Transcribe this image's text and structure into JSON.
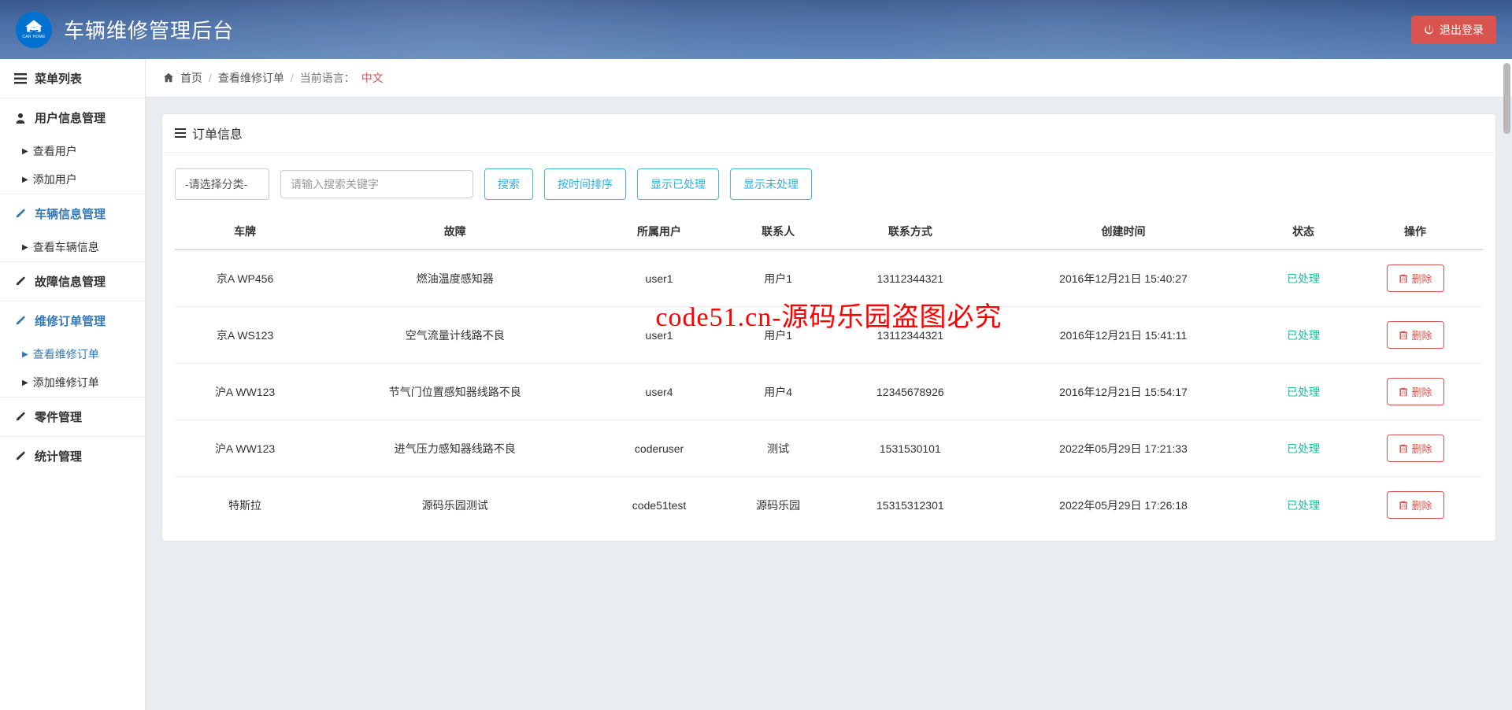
{
  "header": {
    "title": "车辆维修管理后台",
    "logo_text": "CAR HOME",
    "logout": "退出登录"
  },
  "sidebar": {
    "heading": "菜单列表",
    "groups": [
      {
        "icon": "user",
        "label": "用户信息管理",
        "active": false,
        "subs": [
          {
            "label": "查看用户",
            "active": false
          },
          {
            "label": "添加用户",
            "active": false
          }
        ]
      },
      {
        "icon": "edit",
        "label": "车辆信息管理",
        "active": true,
        "subs": [
          {
            "label": "查看车辆信息",
            "active": false
          }
        ]
      },
      {
        "icon": "edit",
        "label": "故障信息管理",
        "active": false,
        "subs": []
      },
      {
        "icon": "edit",
        "label": "维修订单管理",
        "active": true,
        "subs": [
          {
            "label": "查看维修订单",
            "active": true
          },
          {
            "label": "添加维修订单",
            "active": false
          }
        ]
      },
      {
        "icon": "edit",
        "label": "零件管理",
        "active": false,
        "subs": []
      },
      {
        "icon": "edit",
        "label": "统计管理",
        "active": false,
        "subs": []
      }
    ]
  },
  "breadcrumb": {
    "home": "首页",
    "current": "查看维修订单",
    "lang_label": "当前语言：",
    "lang_value": "中文"
  },
  "panel": {
    "title": "订单信息",
    "category_placeholder": "-请选择分类-",
    "search_placeholder": "请输入搜索关键字",
    "btn_search": "搜索",
    "btn_sort_time": "按时间排序",
    "btn_show_done": "显示已处理",
    "btn_show_undone": "显示未处理"
  },
  "table": {
    "columns": [
      "车牌",
      "故障",
      "所属用户",
      "联系人",
      "联系方式",
      "创建时间",
      "状态",
      "操作"
    ],
    "delete_label": "删除",
    "rows": [
      {
        "plate": "京A WP456",
        "fault": "燃油温度感知器",
        "user": "user1",
        "contact": "用户1",
        "phone": "13112344321",
        "time": "2016年12月21日 15:40:27",
        "status": "已处理"
      },
      {
        "plate": "京A WS123",
        "fault": "空气流量计线路不良",
        "user": "user1",
        "contact": "用户1",
        "phone": "13112344321",
        "time": "2016年12月21日 15:41:11",
        "status": "已处理"
      },
      {
        "plate": "沪A WW123",
        "fault": "节气门位置感知器线路不良",
        "user": "user4",
        "contact": "用户4",
        "phone": "12345678926",
        "time": "2016年12月21日 15:54:17",
        "status": "已处理"
      },
      {
        "plate": "沪A WW123",
        "fault": "进气压力感知器线路不良",
        "user": "coderuser",
        "contact": "测试",
        "phone": "1531530101",
        "time": "2022年05月29日 17:21:33",
        "status": "已处理"
      },
      {
        "plate": "特斯拉",
        "fault": "源码乐园测试",
        "user": "code51test",
        "contact": "源码乐园",
        "phone": "15315312301",
        "time": "2022年05月29日 17:26:18",
        "status": "已处理"
      }
    ]
  },
  "watermark": "code51.cn-源码乐园盗图必究"
}
